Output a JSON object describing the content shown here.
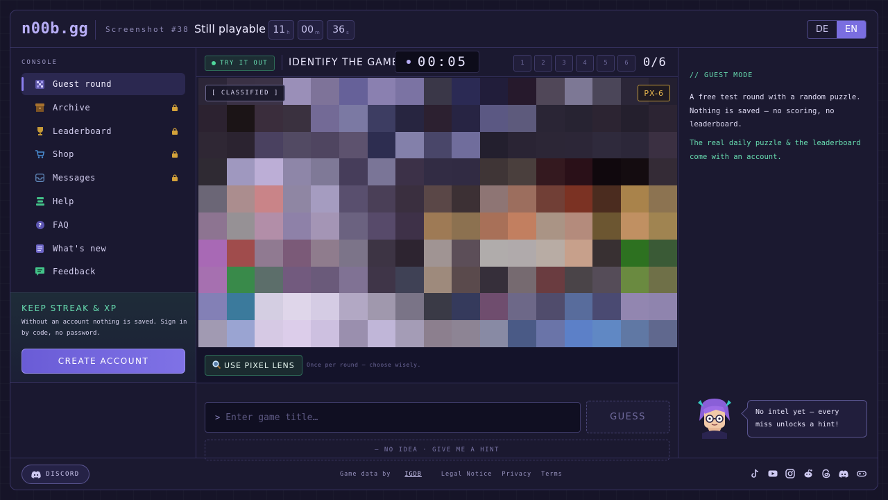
{
  "header": {
    "logo": "n00b.gg",
    "screenshot_label": "Screenshot #38",
    "status": "Still playable",
    "countdown": [
      {
        "value": "11",
        "unit": "h"
      },
      {
        "value": "00",
        "unit": "m"
      },
      {
        "value": "36",
        "unit": "s"
      }
    ],
    "languages": [
      "DE",
      "EN"
    ],
    "active_language": "EN"
  },
  "sidebar": {
    "section_label": "CONSOLE",
    "items": [
      {
        "label": "Guest round",
        "icon": "grid-icon",
        "locked": false,
        "active": true
      },
      {
        "label": "Archive",
        "icon": "archive-box-icon",
        "locked": true
      },
      {
        "label": "Leaderboard",
        "icon": "trophy-icon",
        "locked": true
      },
      {
        "label": "Shop",
        "icon": "cart-icon",
        "locked": true
      },
      {
        "label": "Messages",
        "icon": "inbox-icon",
        "locked": true
      },
      {
        "label": "Help",
        "icon": "lifebuoy-icon",
        "locked": false
      },
      {
        "label": "FAQ",
        "icon": "question-icon",
        "locked": false
      },
      {
        "label": "What's new",
        "icon": "document-icon",
        "locked": false
      },
      {
        "label": "Feedback",
        "icon": "chat-icon",
        "locked": false
      }
    ],
    "streak": {
      "title": "KEEP STREAK & XP",
      "text": "Without an account nothing is saved. Sign in by code, no password.",
      "button": "CREATE ACCOUNT"
    }
  },
  "game": {
    "badge": "TRY IT OUT",
    "title": "IDENTIFY THE GAME",
    "timer": "00:05",
    "steps": [
      "1",
      "2",
      "3",
      "4",
      "5",
      "6"
    ],
    "score": "0/6",
    "classified": "[ CLASSIFIED ]",
    "pixel_level": "PX-6",
    "lens_button": "USE PIXEL LENS",
    "lens_note": "Once per round — choose wisely.",
    "input_prompt": ">",
    "input_placeholder": "Enter game title…",
    "guess_button": "GUESS",
    "hint_button": "— NO IDEA · GIVE ME A HINT"
  },
  "pixel_colors": [
    [
      "#2c2638",
      "#3a3145",
      "#3b3246",
      "#9a8fb8",
      "#7e7399",
      "#666199",
      "#8a80b0",
      "#7b73a3",
      "#3a3748",
      "#2b2a54",
      "#211d3a",
      "#26192c",
      "#504758",
      "#7d7895",
      "#4b4659",
      "#2b2638",
      "#231f30"
    ],
    [
      "#2c2230",
      "#1b1416",
      "#3a2d3c",
      "#3a313f",
      "#736a96",
      "#7b79a3",
      "#3d3d62",
      "#272540",
      "#2c2030",
      "#272443",
      "#5b5883",
      "#5d5a7c",
      "#2a2535",
      "#272332",
      "#2c2432",
      "#241f2d",
      "#2c2433"
    ],
    [
      "#2f2734",
      "#2b2330",
      "#4a4160",
      "#524a63",
      "#4f4560",
      "#5d526e",
      "#2d2d50",
      "#8380aa",
      "#494669",
      "#706d9c",
      "#231f2e",
      "#2a2434",
      "#2c2636",
      "#2c2637",
      "#2f2a3c",
      "#2c2739",
      "#3b3042"
    ],
    [
      "#2f2a33",
      "#9f98bf",
      "#bcaed6",
      "#8e86a8",
      "#7f7997",
      "#463d5a",
      "#7a7597",
      "#3c3148",
      "#322c44",
      "#312b43",
      "#3f3536",
      "#4a3f3d",
      "#34191f",
      "#2a1018",
      "#10080d",
      "#140c10",
      "#342b36"
    ],
    [
      "#6b6676",
      "#ab8d8e",
      "#c98488",
      "#8f86a3",
      "#a59cc0",
      "#594f6e",
      "#4a3f57",
      "#3a2f3f",
      "#5a4747",
      "#3c3034",
      "#8e7574",
      "#9c6e5e",
      "#713f36",
      "#7b3223",
      "#4b2c1f",
      "#a9834b",
      "#8c7351"
    ],
    [
      "#8d7491",
      "#969195",
      "#b28ea8",
      "#8e81a8",
      "#a495b5",
      "#6b6280",
      "#574a6a",
      "#3e3148",
      "#9e7a55",
      "#8c7150",
      "#a87058",
      "#c27f60",
      "#aa9485",
      "#b48b7c",
      "#6c5631",
      "#c09062",
      "#a08451"
    ],
    [
      "#a869b5",
      "#a04c4c",
      "#907a91",
      "#7b5a78",
      "#8f7c8d",
      "#7c7489",
      "#3d3444",
      "#2d2430",
      "#a09493",
      "#5c4e58",
      "#b0acab",
      "#b0aaab",
      "#b8aca4",
      "#c7a08b",
      "#383032",
      "#2d7120",
      "#3a5a36"
    ],
    [
      "#a670b0",
      "#398a4a",
      "#5c6e6a",
      "#725a7e",
      "#6a5a7a",
      "#807294",
      "#3f3548",
      "#3f4155",
      "#9e8a7c",
      "#5a4a4c",
      "#362f3a",
      "#766a70",
      "#6a3c40",
      "#4a4448",
      "#554c58",
      "#6a8a40",
      "#6f7048"
    ],
    [
      "#8380b6",
      "#3b7a9c",
      "#d4cee2",
      "#dfd6ea",
      "#d5cce4",
      "#b2a8c4",
      "#a098ad",
      "#7a7487",
      "#3a3a46",
      "#353a5c",
      "#6f4d6e",
      "#6d6888",
      "#504c6c",
      "#586c9c",
      "#4a4a72",
      "#9286b0",
      "#8f84ae"
    ],
    [
      "#a19ab2",
      "#9aa4d2",
      "#d6c9e4",
      "#dccdea",
      "#cdc0e0",
      "#9a8fae",
      "#c0b6d8",
      "#a49cb6",
      "#8c7f8e",
      "#8d8494",
      "#888aa4",
      "#4a5a86",
      "#6a74a8",
      "#5c80c8",
      "#6088c4",
      "#6078a4",
      "#60688e"
    ]
  ],
  "guest_panel": {
    "title": "// GUEST MODE",
    "paragraph1": "A free test round with a random puzzle. Nothing is saved — no scoring, no leaderboard.",
    "paragraph2": "The real daily puzzle & the leaderboard come with an account.",
    "bubble": "No intel yet — every miss unlocks a hint!"
  },
  "footer": {
    "discord": "DISCORD",
    "game_data_prefix": "Game data by",
    "igdb": "IGDB",
    "links": [
      "Legal Notice",
      "Privacy",
      "Terms"
    ],
    "socials": [
      "tiktok-icon",
      "youtube-icon",
      "instagram-icon",
      "reddit-icon",
      "threads-icon",
      "discord-icon",
      "gamepad-icon"
    ]
  },
  "colors": {
    "accent": "#7a6ee0",
    "green": "#67dcb0",
    "gold": "#e9b84f",
    "background": "#1b1930"
  }
}
